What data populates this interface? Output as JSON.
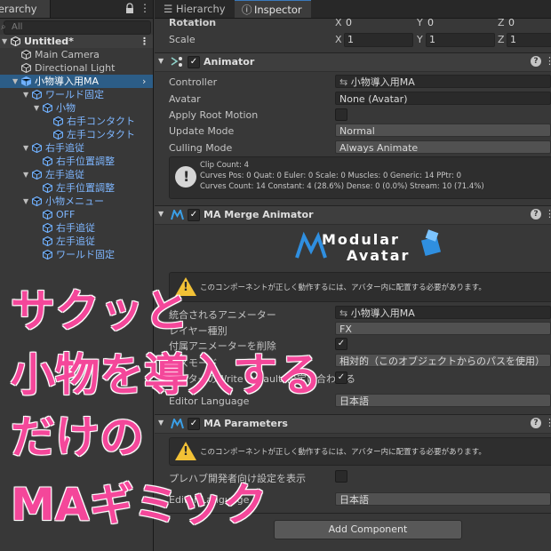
{
  "hierarchy": {
    "tab_label": "Hierarchy",
    "search_placeholder": "All",
    "rows": [
      {
        "label": "Untitled*",
        "depth": 0,
        "kind": "root"
      },
      {
        "label": "Main Camera",
        "depth": 1,
        "kind": "item"
      },
      {
        "label": "Directional Light",
        "depth": 1,
        "kind": "item"
      },
      {
        "label": "小物導入用MA",
        "depth": 1,
        "kind": "selected"
      },
      {
        "label": "ワールド固定",
        "depth": 2,
        "kind": "prefab"
      },
      {
        "label": "小物",
        "depth": 3,
        "kind": "prefab"
      },
      {
        "label": "右手コンタクト",
        "depth": 4,
        "kind": "prefab"
      },
      {
        "label": "左手コンタクト",
        "depth": 4,
        "kind": "prefab"
      },
      {
        "label": "右手追従",
        "depth": 2,
        "kind": "prefab"
      },
      {
        "label": "右手位置調整",
        "depth": 3,
        "kind": "prefab"
      },
      {
        "label": "左手追従",
        "depth": 2,
        "kind": "prefab"
      },
      {
        "label": "左手位置調整",
        "depth": 3,
        "kind": "prefab"
      },
      {
        "label": "小物メニュー",
        "depth": 2,
        "kind": "prefab"
      },
      {
        "label": "OFF",
        "depth": 3,
        "kind": "prefab"
      },
      {
        "label": "右手追従",
        "depth": 3,
        "kind": "prefab"
      },
      {
        "label": "左手追従",
        "depth": 3,
        "kind": "prefab"
      },
      {
        "label": "ワールド固定",
        "depth": 3,
        "kind": "prefab"
      }
    ]
  },
  "inspector": {
    "tabs": {
      "hierarchy": "Hierarchy",
      "inspector": "Inspector"
    },
    "transform": {
      "rotation_label": "Rotation",
      "rotation": {
        "x": "0",
        "y": "0",
        "z": "0"
      },
      "scale_label": "Scale",
      "scale": {
        "x": "1",
        "y": "1",
        "z": "1"
      }
    },
    "animator": {
      "title": "Animator",
      "controller_label": "Controller",
      "controller_value": "小物導入用MA",
      "avatar_label": "Avatar",
      "avatar_value": "None (Avatar)",
      "apply_root_motion_label": "Apply Root Motion",
      "update_mode_label": "Update Mode",
      "update_mode_value": "Normal",
      "culling_mode_label": "Culling Mode",
      "culling_mode_value": "Always Animate",
      "info": [
        "Clip Count: 4",
        "Curves Pos: 0 Quat: 0 Euler: 0 Scale: 0 Muscles: 0 Generic: 14 PPtr: 0",
        "Curves Count: 14 Constant: 4 (28.6%) Dense: 0 (0.0%) Stream: 10 (71.4%)"
      ]
    },
    "merge_animator": {
      "title": "MA Merge Animator",
      "logo_line1": "Modular",
      "logo_line2": "Avatar",
      "warning": "このコンポーネントが正しく動作するには、アバター内に配置する必要があります。",
      "animator_label": "統合されるアニメーター",
      "animator_value": "小物導入用MA",
      "layer_type_label": "レイヤー種別",
      "layer_type_value": "FX",
      "delete_label": "付属アニメーターを削除",
      "path_mode_label": "パスモード",
      "path_mode_value": "相対的（このオブジェクトからのパスを使用）",
      "write_defaults_label": "アバターのWrite Defaults設定に合わせる",
      "language_label": "Editor Language",
      "language_value": "日本語"
    },
    "parameters": {
      "title": "MA Parameters",
      "warning": "このコンポーネントが正しく動作するには、アバター内に配置する必要があります。",
      "prefab_dev_label": "プレハブ開発者向け設定を表示",
      "language_label": "Editor Language",
      "language_value": "日本語"
    },
    "add_component_label": "Add Component"
  },
  "overlay": {
    "line1": "サクッと",
    "line2": "小物を導入する",
    "line3": "だけの",
    "line4": "MAギミック"
  },
  "colors": {
    "overlay_pink": "#f4479a",
    "selection": "#2c5d87",
    "prefab_blue": "#7eb6ff"
  }
}
